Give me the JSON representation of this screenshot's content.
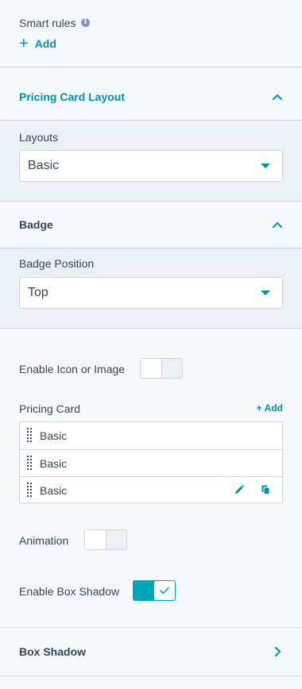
{
  "smart_rules": {
    "label": "Smart rules",
    "info_glyph": "i",
    "add_label": "Add"
  },
  "sections": {
    "pricing_card_layout": {
      "title": "Pricing Card Layout",
      "layouts_label": "Layouts",
      "layouts_value": "Basic"
    },
    "badge": {
      "title": "Badge",
      "position_label": "Badge Position",
      "position_value": "Top"
    },
    "box_shadow": {
      "title": "Box Shadow"
    }
  },
  "enable_icon_or_image": {
    "label": "Enable Icon or Image",
    "enabled": false
  },
  "pricing_card": {
    "label": "Pricing Card",
    "add_label": "+ Add",
    "items": [
      {
        "label": "Basic"
      },
      {
        "label": "Basic"
      },
      {
        "label": "Basic"
      }
    ],
    "item_action_icons": [
      "pencil-icon",
      "copy-icon"
    ]
  },
  "animation": {
    "label": "Animation",
    "enabled": false
  },
  "enable_box_shadow": {
    "label": "Enable Box Shadow",
    "enabled": true
  },
  "colors": {
    "accent": "#0091ae",
    "toggle_on": "#00a4bd",
    "text": "#33475b",
    "border": "#cbd6e2",
    "panel_bg": "#f5f8fa",
    "shaded_bg": "#eaf0f6"
  }
}
